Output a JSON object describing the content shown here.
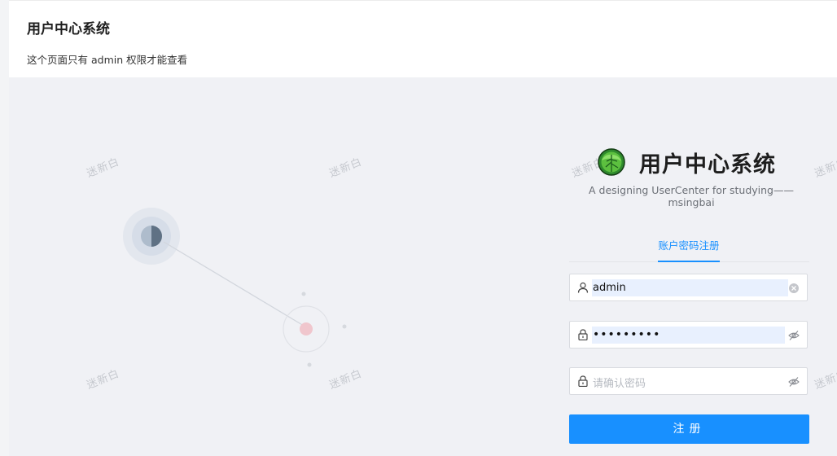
{
  "header": {
    "title": "用户中心系统",
    "subtitle": "这个页面只有 admin 权限才能查看"
  },
  "watermark": "迷新白",
  "login": {
    "brand_title": "用户中心系统",
    "brand_subtitle": "A designing UserCenter for studying——msingbai",
    "tab_label": "账户密码注册",
    "username_value": "admin",
    "password_value": "•••••••••",
    "confirm_placeholder": "请确认密码",
    "submit_label": "注册"
  },
  "colors": {
    "accent": "#1890ff",
    "background": "#f0f1f5",
    "autofill": "#e8f0fe"
  },
  "icons": [
    "cabbage-logo-icon",
    "user-icon",
    "lock-icon",
    "clear-icon",
    "eye-invisible-icon"
  ]
}
